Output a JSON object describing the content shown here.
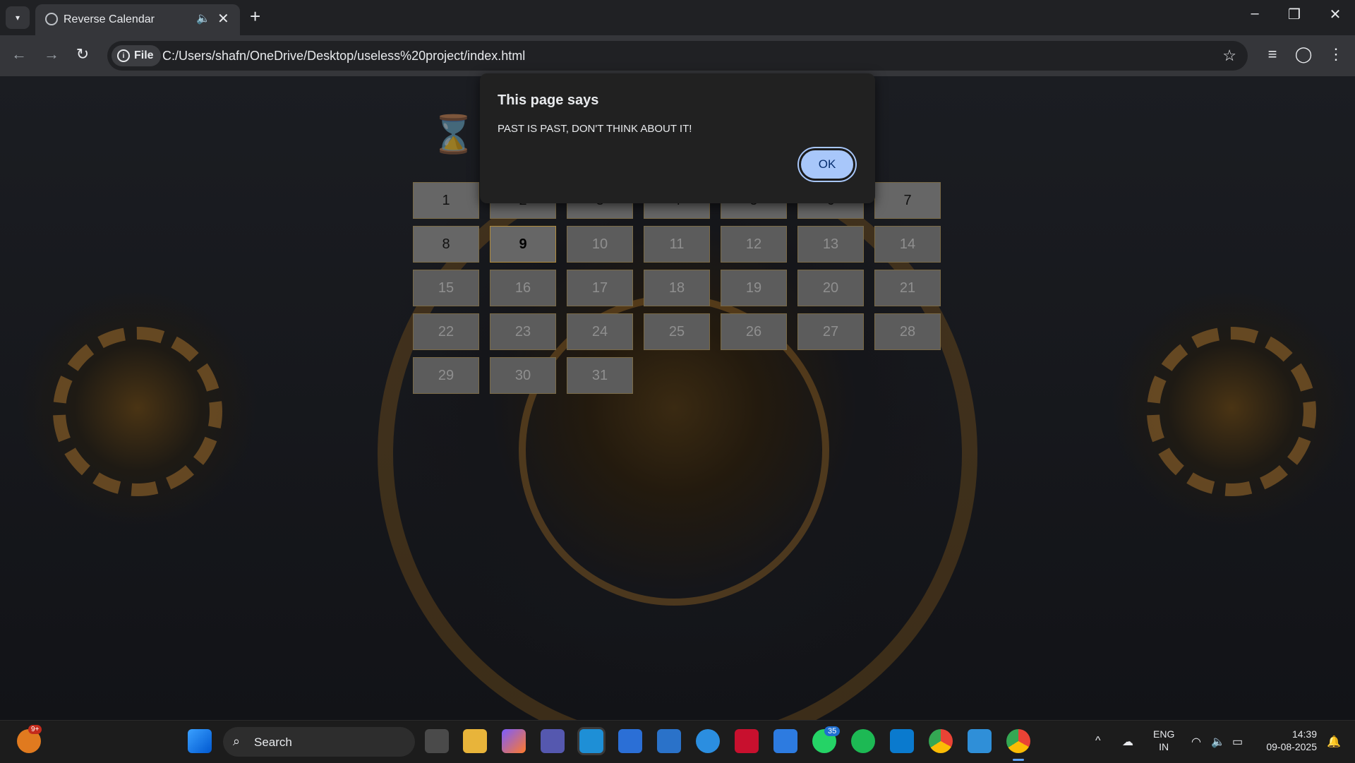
{
  "browser": {
    "tab_title": "Reverse Calendar",
    "url": "C:/Users/shafn/OneDrive/Desktop/useless%20project/index.html",
    "scheme_chip": "File",
    "icons": [
      "tab-search-icon",
      "globe-icon",
      "audio-icon",
      "close-icon",
      "new-tab-icon",
      "minimize-icon",
      "restore-icon",
      "window-close-icon",
      "back-icon",
      "forward-icon",
      "reload-icon",
      "info-icon",
      "star-icon",
      "reading-list-icon",
      "profile-icon",
      "menu-icon"
    ]
  },
  "page": {
    "heading_partial": "⌛Q                    TS",
    "calendar": {
      "days": [
        "1",
        "2",
        "3",
        "4",
        "5",
        "6",
        "7",
        "8",
        "9",
        "10",
        "11",
        "12",
        "13",
        "14",
        "15",
        "16",
        "17",
        "18",
        "19",
        "20",
        "21",
        "22",
        "23",
        "24",
        "25",
        "26",
        "27",
        "28",
        "29",
        "30",
        "31"
      ],
      "today": "9",
      "past_days": [
        "1",
        "2",
        "3",
        "4",
        "5",
        "6",
        "7",
        "8"
      ]
    }
  },
  "dialog": {
    "title": "This page says",
    "message": "PAST IS PAST, DON'T THINK ABOUT IT!",
    "ok_label": "OK"
  },
  "taskbar": {
    "weather_badge": "9+",
    "search_label": "Search",
    "whatsapp_badge": "35",
    "language_line1": "ENG",
    "language_line2": "IN",
    "time": "14:39",
    "date": "09-08-2025",
    "accent_colors": {
      "dialog_button": "#a8c7fa",
      "weather": "#e07a1f"
    }
  }
}
